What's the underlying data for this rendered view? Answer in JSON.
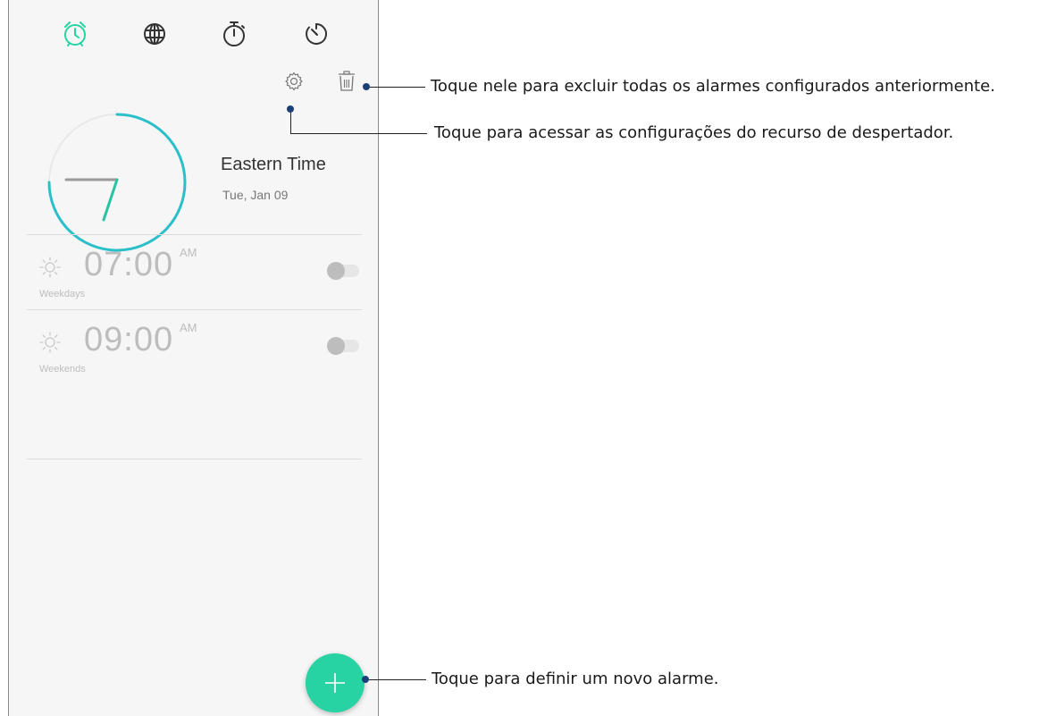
{
  "colors": {
    "accent": "#27d3a3",
    "clock_ring": "#2bbfc9",
    "inactive": "#bdbdbd",
    "callout_dot": "#1d3f78"
  },
  "tabs": [
    {
      "icon": "alarm-clock-icon",
      "active": true
    },
    {
      "icon": "globe-icon",
      "active": false
    },
    {
      "icon": "stopwatch-icon",
      "active": false
    },
    {
      "icon": "timer-icon",
      "active": false
    }
  ],
  "toolbar": {
    "settings_icon": "gear-icon",
    "delete_icon": "trash-icon"
  },
  "world_clock": {
    "city": "Eastern Time",
    "date": "Tue, Jan 09"
  },
  "alarms": [
    {
      "time": "07:00",
      "ampm": "AM",
      "repeat": "Weekdays",
      "enabled": false,
      "icon": "sun-icon"
    },
    {
      "time": "09:00",
      "ampm": "AM",
      "repeat": "Weekends",
      "enabled": false,
      "icon": "sun-icon"
    }
  ],
  "fab": {
    "icon": "plus-icon"
  },
  "callouts": {
    "delete": "Toque nele para excluir todas os alarmes configurados anteriormente.",
    "settings": "Toque para acessar as configurações do recurso de despertador.",
    "add": "Toque para definir um novo alarme."
  }
}
